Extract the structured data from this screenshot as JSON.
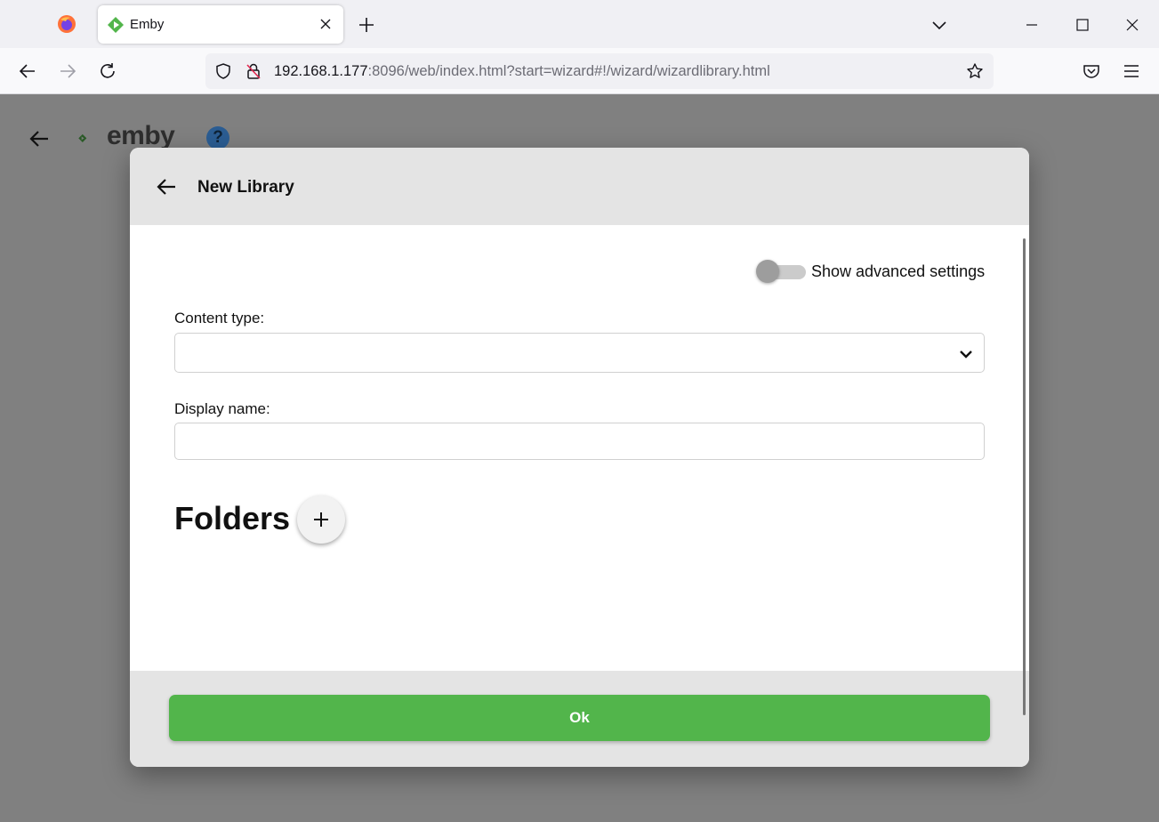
{
  "browser": {
    "tab_title": "Emby",
    "url_host": "192.168.1.177",
    "url_rest": ":8096/web/index.html?start=wizard#!/wizard/wizardlibrary.html"
  },
  "page": {
    "logo_text": "emby",
    "help_label": "?"
  },
  "dialog": {
    "title": "New Library",
    "advanced_toggle": {
      "label": "Show advanced settings",
      "on": false
    },
    "content_type": {
      "label": "Content type:",
      "value": ""
    },
    "display_name": {
      "label": "Display name:",
      "value": ""
    },
    "folders_title": "Folders",
    "ok_label": "Ok"
  },
  "colors": {
    "accent": "#52b54b",
    "overlay": "#808080",
    "header": "#e4e4e4"
  }
}
